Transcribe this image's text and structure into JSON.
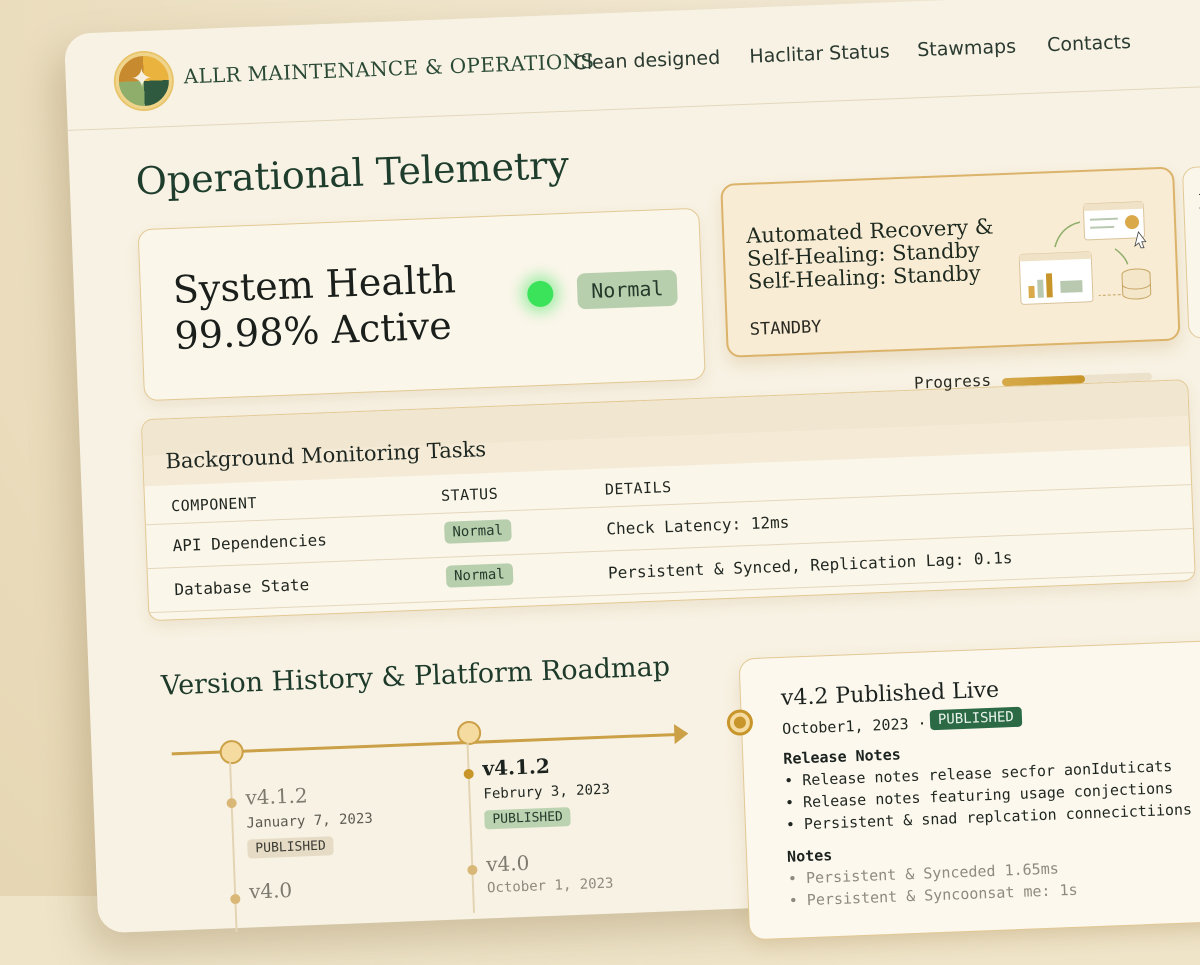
{
  "header": {
    "brand": "ALLR MAINTENANCE & OPERATIONS",
    "nav": [
      "Clean designed",
      "Haclitar Status",
      "Stawmaps",
      "Contacts"
    ]
  },
  "telemetry": {
    "title": "Operational Telemetry",
    "health": {
      "line1": "System Health",
      "line2": "99.98% Active",
      "status": "Normal",
      "status_color": "#3be35a"
    },
    "recovery": {
      "title_lines": [
        "Automated Recovery &",
        "Self-Healing: Standby",
        "Self-Healing: Standby"
      ],
      "status": "STANDBY"
    }
  },
  "tasks": {
    "progress_label": "Progress",
    "progress_value": 0.55,
    "title": "Background Monitoring Tasks",
    "columns": [
      "COMPONENT",
      "STATUS",
      "DETAILS"
    ],
    "rows": [
      {
        "component": "API Dependencies",
        "status": "Normal",
        "details": "Check Latency: 12ms"
      },
      {
        "component": "Database State",
        "status": "Normal",
        "details": "Persistent & Synced, Replication Lag: 0.1s"
      }
    ]
  },
  "roadmap": {
    "title": "Version History & Platform Roadmap",
    "col1": [
      {
        "version": "v4.1.2",
        "date": "January 7, 2023",
        "badge": "PUBLISHED"
      },
      {
        "version": "v4.0",
        "date": "",
        "badge": ""
      }
    ],
    "col2": [
      {
        "version": "v4.1.2",
        "date": "Februry 3, 2023",
        "badge": "PUBLISHED"
      },
      {
        "version": "v4.0",
        "date": "October 1, 2023",
        "badge": ""
      }
    ],
    "live": {
      "title": "v4.2 Published Live",
      "date": "October1, 2023 ·",
      "badge": "PUBLISHED",
      "notes_heading": "Release Notes",
      "notes": [
        "• Release notes release secfor aonIduticats",
        "• Release notes featuring usage conjections",
        "• Persistent & snad replcation connecictiions"
      ],
      "notes2_heading": "Notes",
      "notes2": [
        "• Persistent & Synceded 1.65ms",
        "• Persistent & Syncoonsat me: 1s"
      ]
    }
  },
  "colors": {
    "accent": "#cba047",
    "brand_green": "#1e3d2c",
    "pill_green": "#b8cfae"
  }
}
